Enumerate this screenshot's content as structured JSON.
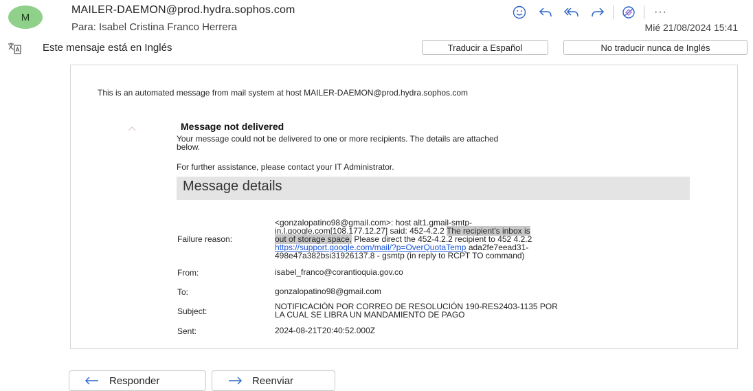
{
  "header": {
    "avatar_initial": "M",
    "sender": "MAILER-DAEMON@prod.hydra.sophos.com",
    "to_prefix": "Para:",
    "to_name": "Isabel Cristina Franco Herrera",
    "date": "Mié 21/08/2024 15:41",
    "actions": [
      "smile-icon",
      "reply-icon",
      "reply-all-icon",
      "forward-icon",
      "loop-icon",
      "more-icon"
    ],
    "more_label": "···"
  },
  "translate_bar": {
    "message": "Este mensaje está en Inglés",
    "translate_button": "Traducir a Español",
    "never_button": "No traducir nunca de Inglés"
  },
  "body": {
    "automated_message": "This is an automated message from mail system at host MAILER-DAEMON@prod.hydra.sophos.com",
    "title": "Message not delivered",
    "description_line1": "Your message could not be delivered to one or more recipients. The details are attached",
    "description_line2": "below.",
    "assistance": "For further assistance, please contact your IT Administrator.",
    "details_title": "Message details",
    "failure_label": "Failure reason:",
    "failure_line1": "<gonzalopatino98@gmail.com>: host alt1.gmail-smtp-",
    "failure_line2_a": "in.l.google.com[108.177.12.27] said: 452-4.2.2 ",
    "failure_line2_hl": "The recipient's inbox is",
    "failure_line3_hl": "out of storage space.",
    "failure_line3_b": " Please direct the 452-4.2.2 recipient to 452 4.2.2",
    "failure_link": "https://support.google.com/mail/?p=OverQuotaTemp",
    "failure_line4_b": " ada2fe7eead31-",
    "failure_line5": "498e47a382bsi31926137.8 - gsmtp (in reply to RCPT TO command)",
    "from_label": "From:",
    "from_value": "isabel_franco@corantioquia.gov.co",
    "to_label": "To:",
    "to_value": "gonzalopatino98@gmail.com",
    "subject_label": "Subject:",
    "subject_line1": "NOTIFICACIÓN POR CORREO DE RESOLUCIÓN 190-RES2403-1135 POR",
    "subject_line2": "LA CUAL SE LIBRA UN MANDAMIENTO DE PAGO",
    "sent_label": "Sent:",
    "sent_value": "2024-08-21T20:40:52.000Z"
  },
  "footer": {
    "reply_button": "Responder",
    "forward_button": "Reenviar"
  },
  "colors": {
    "avatar_bg": "#8fd18a",
    "accent": "#1a55d8",
    "highlight": "#c8c8c8"
  }
}
